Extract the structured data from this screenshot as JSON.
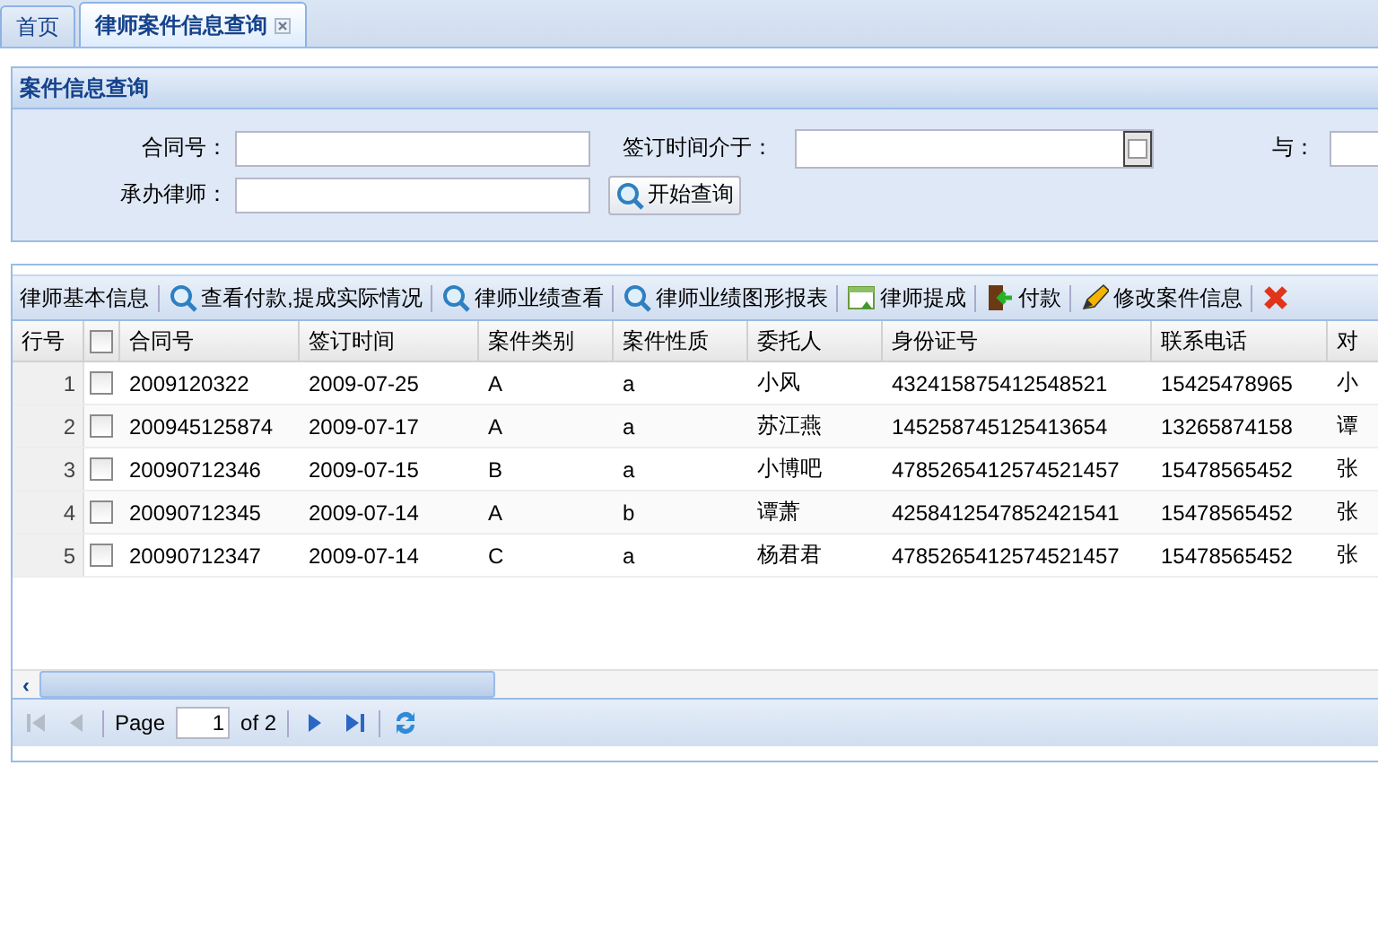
{
  "tabs": [
    {
      "label": "首页",
      "selected": false,
      "closable": false
    },
    {
      "label": "律师案件信息查询",
      "selected": true,
      "closable": true
    }
  ],
  "search_panel": {
    "title": "案件信息查询",
    "rows": [
      [
        {
          "label": "合同号：",
          "kind": "text"
        },
        {
          "label": "签订时间介于：",
          "kind": "date"
        },
        {
          "label": "与：",
          "kind": "text"
        }
      ],
      [
        {
          "label": "承办律师：",
          "kind": "text"
        },
        {
          "label": "开始查询",
          "kind": "button"
        }
      ]
    ]
  },
  "toolbar": [
    {
      "label": "律师基本信息",
      "kind": "none"
    },
    {
      "label": "查看付款,提成实际情况",
      "kind": "search"
    },
    {
      "label": "律师业绩查看",
      "kind": "search"
    },
    {
      "label": "律师业绩图形报表",
      "kind": "search"
    },
    {
      "label": "律师提成",
      "kind": "chart"
    },
    {
      "label": "付款",
      "kind": "door"
    },
    {
      "label": "修改案件信息",
      "kind": "pencil"
    },
    {
      "kind": "delete"
    }
  ],
  "table": {
    "row_number_header": "行号",
    "select_all_checked": false,
    "columns": [
      "合同号",
      "签订时间",
      "案件类别",
      "案件性质",
      "委托人",
      "身份证号",
      "联系电话",
      "对"
    ],
    "rows": [
      {
        "number": "1",
        "checked": false,
        "cells": [
          "2009120322",
          "2009-07-25",
          "A",
          "a",
          "小风",
          "432415875412548521",
          "15425478965",
          "小"
        ]
      },
      {
        "number": "2",
        "checked": false,
        "cells": [
          "200945125874",
          "2009-07-17",
          "A",
          "a",
          "苏江燕",
          "145258745125413654",
          "13265874158",
          "谭"
        ]
      },
      {
        "number": "3",
        "checked": false,
        "cells": [
          "20090712346",
          "2009-07-15",
          "B",
          "a",
          "小博吧",
          "4785265412574521457",
          "15478565452",
          "张"
        ]
      },
      {
        "number": "4",
        "checked": false,
        "cells": [
          "20090712345",
          "2009-07-14",
          "A",
          "b",
          "谭萧",
          "4258412547852421541",
          "15478565452",
          "张"
        ]
      },
      {
        "number": "5",
        "checked": false,
        "cells": [
          "20090712347",
          "2009-07-14",
          "C",
          "a",
          "杨君君",
          "4785265412574521457",
          "15478565452",
          "张"
        ]
      }
    ]
  },
  "scrollbar": {
    "arrow": "‹"
  },
  "pager": {
    "label": "Page",
    "page": "1",
    "total": "of 2",
    "buttons": [
      {
        "kind": "first",
        "disabled": true
      },
      {
        "kind": "prev",
        "disabled": true
      },
      {
        "kind": "next",
        "disabled": false
      },
      {
        "kind": "last",
        "disabled": false
      },
      {
        "kind": "refresh",
        "disabled": false
      }
    ]
  }
}
